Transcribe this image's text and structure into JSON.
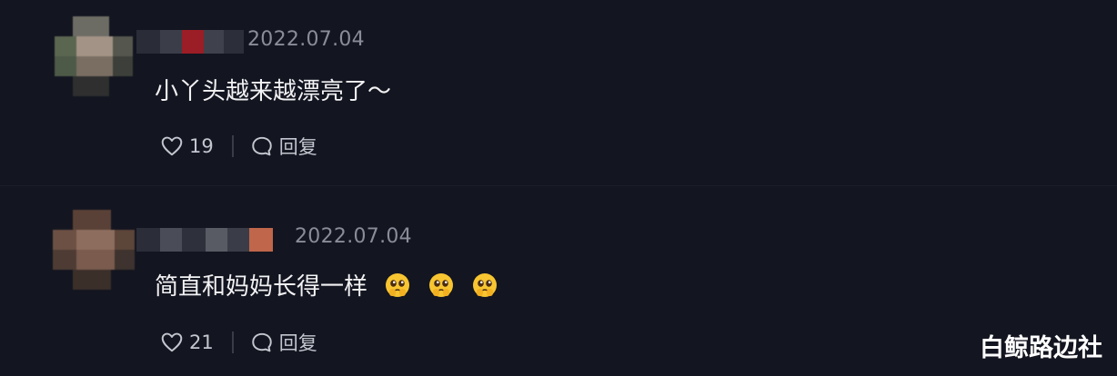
{
  "comments": [
    {
      "date": "2022.07.04",
      "text": "小丫头越来越漂亮了～",
      "like_count": "19",
      "reply_label": "回复",
      "emojis": []
    },
    {
      "date": "2022.07.04",
      "text": "简直和妈妈长得一样",
      "like_count": "21",
      "reply_label": "回复",
      "emojis": [
        "pleading-face",
        "pleading-face",
        "pleading-face"
      ]
    }
  ],
  "watermark": "白鲸路边社",
  "colors": {
    "background": "#131520",
    "text": "#f2f2f4",
    "meta": "#8a8d99",
    "emoji": "#f7c531"
  },
  "icons": [
    "heart-icon",
    "comment-bubble-icon",
    "pleading-face-emoji"
  ]
}
